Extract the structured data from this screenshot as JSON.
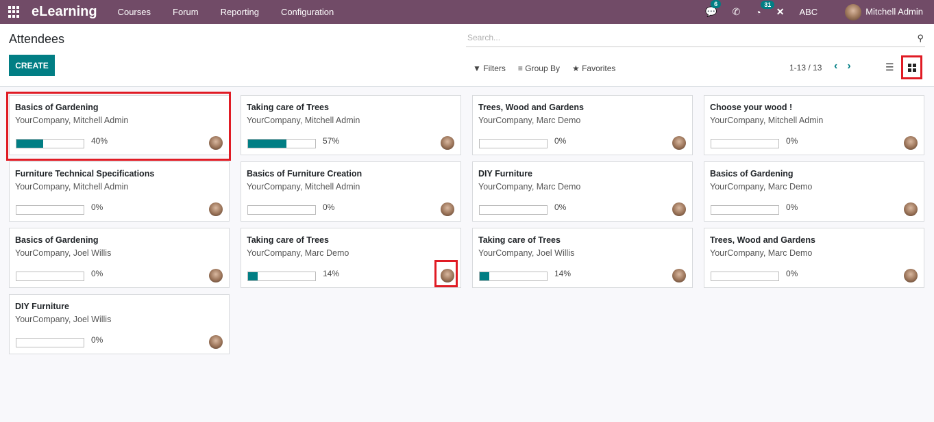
{
  "navbar": {
    "app_name": "eLearning",
    "menu": [
      "Courses",
      "Forum",
      "Reporting",
      "Configuration"
    ],
    "messages_count": "6",
    "activities_count": "31",
    "company": "ABC",
    "user": "Mitchell Admin",
    "bg_color": "#714b67"
  },
  "control": {
    "title": "Attendees",
    "create_label": "CREATE",
    "search_placeholder": "Search...",
    "filters_label": "Filters",
    "groupby_label": "Group By",
    "favorites_label": "Favorites",
    "pager": "1-13 / 13"
  },
  "cards": [
    {
      "title": "Basics of Gardening",
      "subtitle": "YourCompany, Mitchell Admin",
      "progress": 40,
      "pct": "40%"
    },
    {
      "title": "Taking care of Trees",
      "subtitle": "YourCompany, Mitchell Admin",
      "progress": 57,
      "pct": "57%"
    },
    {
      "title": "Trees, Wood and Gardens",
      "subtitle": "YourCompany, Marc Demo",
      "progress": 0,
      "pct": "0%"
    },
    {
      "title": "Choose your wood !",
      "subtitle": "YourCompany, Mitchell Admin",
      "progress": 0,
      "pct": "0%"
    },
    {
      "title": "Furniture Technical Specifications",
      "subtitle": "YourCompany, Mitchell Admin",
      "progress": 0,
      "pct": "0%"
    },
    {
      "title": "Basics of Furniture Creation",
      "subtitle": "YourCompany, Mitchell Admin",
      "progress": 0,
      "pct": "0%"
    },
    {
      "title": "DIY Furniture",
      "subtitle": "YourCompany, Marc Demo",
      "progress": 0,
      "pct": "0%"
    },
    {
      "title": "Basics of Gardening",
      "subtitle": "YourCompany, Marc Demo",
      "progress": 0,
      "pct": "0%"
    },
    {
      "title": "Basics of Gardening",
      "subtitle": "YourCompany, Joel Willis",
      "progress": 0,
      "pct": "0%"
    },
    {
      "title": "Taking care of Trees",
      "subtitle": "YourCompany, Marc Demo",
      "progress": 14,
      "pct": "14%"
    },
    {
      "title": "Taking care of Trees",
      "subtitle": "YourCompany, Joel Willis",
      "progress": 14,
      "pct": "14%"
    },
    {
      "title": "Trees, Wood and Gardens",
      "subtitle": "YourCompany, Marc Demo",
      "progress": 0,
      "pct": "0%"
    },
    {
      "title": "DIY Furniture",
      "subtitle": "YourCompany, Joel Willis",
      "progress": 0,
      "pct": "0%"
    }
  ]
}
